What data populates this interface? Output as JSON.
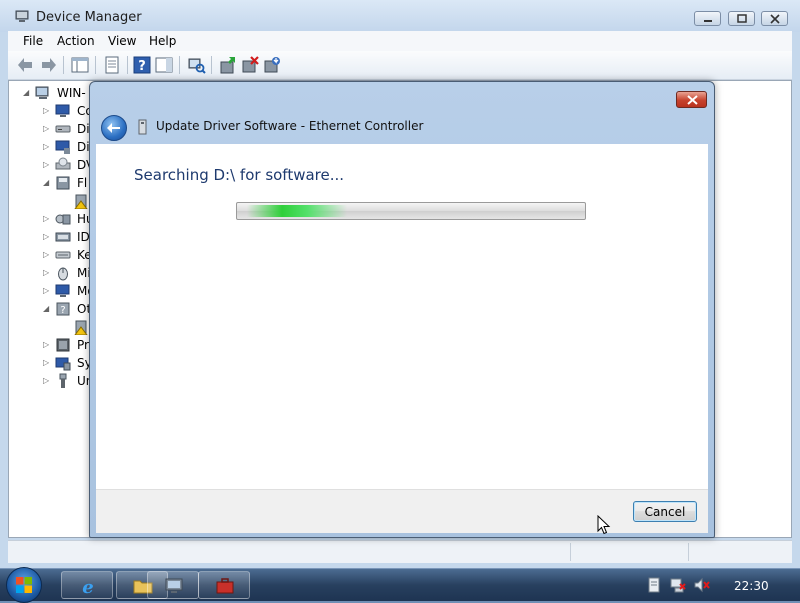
{
  "window": {
    "title": "Device Manager"
  },
  "menu": {
    "file": "File",
    "action": "Action",
    "view": "View",
    "help": "Help"
  },
  "tree": {
    "root": "WIN-",
    "items": [
      "Co",
      "Di",
      "Di",
      "DV",
      "Fl",
      "",
      "Hu",
      "ID",
      "Ke",
      "Mi",
      "Mo",
      "Ot",
      "",
      "Pr",
      "Sy",
      "Un"
    ]
  },
  "dialog": {
    "title": "Update Driver Software - Ethernet Controller",
    "heading": "Searching D:\\ for software...",
    "progress_state": "indeterminate",
    "cancel_label": "Cancel"
  },
  "taskbar": {
    "clock": "22:30"
  },
  "colors": {
    "heading": "#1e3a6e",
    "progress": "#2fcf3a",
    "close": "#c7432e"
  }
}
